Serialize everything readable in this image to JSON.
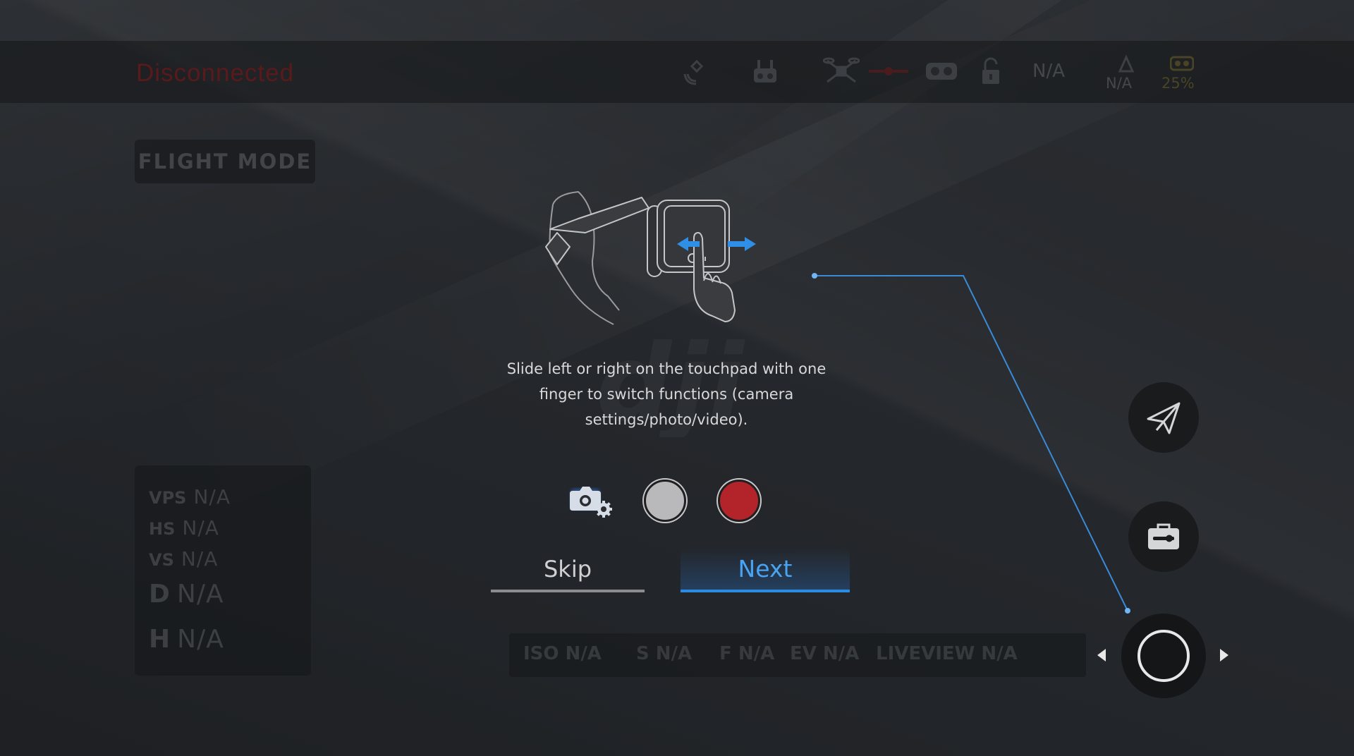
{
  "status": {
    "connection": "Disconnected"
  },
  "top_icons": [
    {
      "name": "gps-satellite-icon"
    },
    {
      "name": "remote-controller-icon"
    },
    {
      "name": "aircraft-icon"
    },
    {
      "name": "video-link-icon"
    },
    {
      "name": "goggles-icon"
    },
    {
      "name": "unlock-icon"
    }
  ],
  "signal": {
    "na": "N/A"
  },
  "obstacle": {
    "value": "N/A"
  },
  "goggles_battery": {
    "value": "25%"
  },
  "flight_mode": {
    "label": "FLIGHT MODE"
  },
  "telemetry": {
    "vps": {
      "label": "VPS",
      "value": "N/A"
    },
    "hs": {
      "label": "HS",
      "value": "N/A"
    },
    "vs": {
      "label": "VS",
      "value": "N/A"
    },
    "d": {
      "label": "D",
      "value": "N/A"
    },
    "h": {
      "label": "H",
      "value": "N/A"
    }
  },
  "camera_params": {
    "iso": "ISO N/A",
    "shutter": "S N/A",
    "aperture": "F N/A",
    "ev": "EV N/A",
    "liveview": "LIVEVIEW N/A"
  },
  "tutorial": {
    "instruction": "Slide left or right on the touchpad with one finger to switch functions (camera settings/photo/video).",
    "skip_label": "Skip",
    "next_label": "Next",
    "modes": [
      "camera-settings-icon",
      "photo-mode-icon",
      "video-mode-icon"
    ]
  },
  "colors": {
    "accent": "#2a8be0",
    "record": "#b3242a",
    "disconnected": "#5a1a1c"
  }
}
